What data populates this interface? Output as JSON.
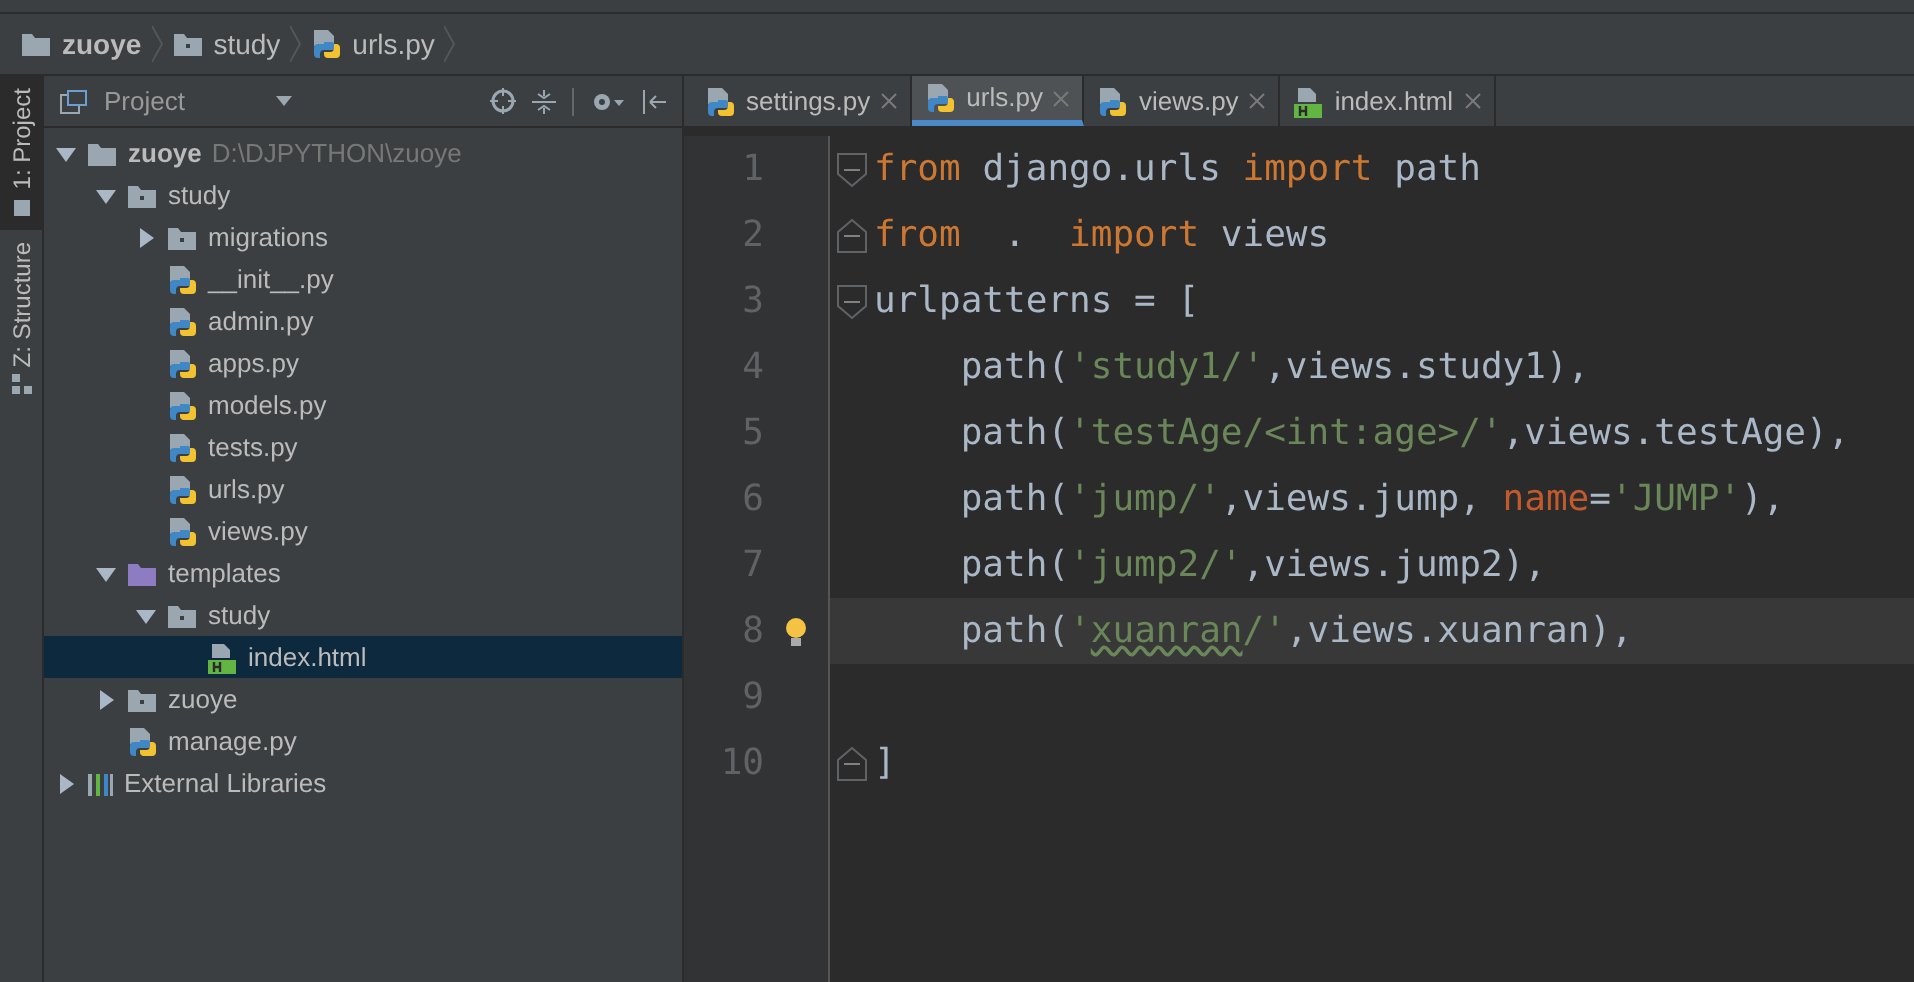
{
  "breadcrumb": [
    {
      "label": "zuoye",
      "kind": "root"
    },
    {
      "label": "study",
      "kind": "package"
    },
    {
      "label": "urls.py",
      "kind": "py"
    }
  ],
  "tool_strip": [
    {
      "label": "1: Project",
      "selected": true
    },
    {
      "label": "Z: Structure",
      "selected": false
    }
  ],
  "project_panel": {
    "title": "Project",
    "tree": [
      {
        "label": "zuoye",
        "path": "D:\\DJPYTHON\\zuoye",
        "kind": "root",
        "expanded": true,
        "selected": false,
        "children": [
          {
            "label": "study",
            "kind": "package",
            "expanded": true,
            "selected": false,
            "children": [
              {
                "label": "migrations",
                "kind": "package",
                "expanded": false,
                "selected": false
              },
              {
                "label": "__init__.py",
                "kind": "py",
                "selected": false
              },
              {
                "label": "admin.py",
                "kind": "py",
                "selected": false
              },
              {
                "label": "apps.py",
                "kind": "py",
                "selected": false
              },
              {
                "label": "models.py",
                "kind": "py",
                "selected": false
              },
              {
                "label": "tests.py",
                "kind": "py",
                "selected": false
              },
              {
                "label": "urls.py",
                "kind": "py",
                "selected": false
              },
              {
                "label": "views.py",
                "kind": "py",
                "selected": false
              }
            ]
          },
          {
            "label": "templates",
            "kind": "templates",
            "expanded": true,
            "selected": false,
            "children": [
              {
                "label": "study",
                "kind": "package",
                "expanded": true,
                "selected": false,
                "children": [
                  {
                    "label": "index.html",
                    "kind": "html",
                    "selected": true
                  }
                ]
              }
            ]
          },
          {
            "label": "zuoye",
            "kind": "package",
            "expanded": false,
            "selected": false
          },
          {
            "label": "manage.py",
            "kind": "py",
            "selected": false
          }
        ]
      },
      {
        "label": "External Libraries",
        "kind": "libraries",
        "expanded": false,
        "selected": false
      }
    ]
  },
  "tabs": [
    {
      "label": "settings.py",
      "kind": "py",
      "selected": false
    },
    {
      "label": "urls.py",
      "kind": "py",
      "selected": true
    },
    {
      "label": "views.py",
      "kind": "py",
      "selected": false
    },
    {
      "label": "index.html",
      "kind": "html",
      "selected": false
    }
  ],
  "editor": {
    "lines": [
      {
        "number": "1",
        "fold_start": true,
        "fold_end": false,
        "current": false,
        "tokens": [
          {
            "text": "from",
            "kind": "keyword"
          },
          {
            "text": " django.urls ",
            "kind": "plain"
          },
          {
            "text": "import",
            "kind": "keyword"
          },
          {
            "text": " path",
            "kind": "plain"
          }
        ]
      },
      {
        "number": "2",
        "fold_start": false,
        "fold_end": true,
        "current": false,
        "tokens": [
          {
            "text": "from",
            "kind": "keyword"
          },
          {
            "text": "  .  ",
            "kind": "plain"
          },
          {
            "text": "import",
            "kind": "keyword"
          },
          {
            "text": " views",
            "kind": "plain"
          }
        ]
      },
      {
        "number": "3",
        "fold_start": true,
        "fold_end": false,
        "current": false,
        "tokens": [
          {
            "text": "urlpatterns = [",
            "kind": "plain"
          }
        ]
      },
      {
        "number": "4",
        "fold_start": false,
        "fold_end": false,
        "current": false,
        "tokens": [
          {
            "text": "    path(",
            "kind": "plain"
          },
          {
            "text": "'study1/'",
            "kind": "string"
          },
          {
            "text": ",views.study1),",
            "kind": "plain"
          }
        ]
      },
      {
        "number": "5",
        "fold_start": false,
        "fold_end": false,
        "current": false,
        "tokens": [
          {
            "text": "    path(",
            "kind": "plain"
          },
          {
            "text": "'testAge/<int:age>/'",
            "kind": "string"
          },
          {
            "text": ",views.testAge),",
            "kind": "plain"
          }
        ]
      },
      {
        "number": "6",
        "fold_start": false,
        "fold_end": false,
        "current": false,
        "tokens": [
          {
            "text": "    path(",
            "kind": "plain"
          },
          {
            "text": "'jump/'",
            "kind": "string"
          },
          {
            "text": ",views.jump, ",
            "kind": "plain"
          },
          {
            "text": "name",
            "kind": "param"
          },
          {
            "text": "=",
            "kind": "plain"
          },
          {
            "text": "'JUMP'",
            "kind": "string"
          },
          {
            "text": "),",
            "kind": "plain"
          }
        ]
      },
      {
        "number": "7",
        "fold_start": false,
        "fold_end": false,
        "current": false,
        "tokens": [
          {
            "text": "    path(",
            "kind": "plain"
          },
          {
            "text": "'jump2/'",
            "kind": "string"
          },
          {
            "text": ",views.jump2),",
            "kind": "plain"
          }
        ]
      },
      {
        "number": "8",
        "fold_start": false,
        "fold_end": false,
        "current": true,
        "tokens": [
          {
            "text": "    path(",
            "kind": "plain"
          },
          {
            "text": "'",
            "kind": "string"
          },
          {
            "text": "xuanran",
            "kind": "typo"
          },
          {
            "text": "/'",
            "kind": "string"
          },
          {
            "text": ",views.xuanran),",
            "kind": "plain"
          }
        ]
      },
      {
        "number": "9",
        "fold_start": false,
        "fold_end": false,
        "current": false
      },
      {
        "number": "10",
        "fold_start": false,
        "fold_end": true,
        "current": false,
        "tokens": [
          {
            "text": "]",
            "kind": "plain"
          }
        ]
      }
    ]
  }
}
